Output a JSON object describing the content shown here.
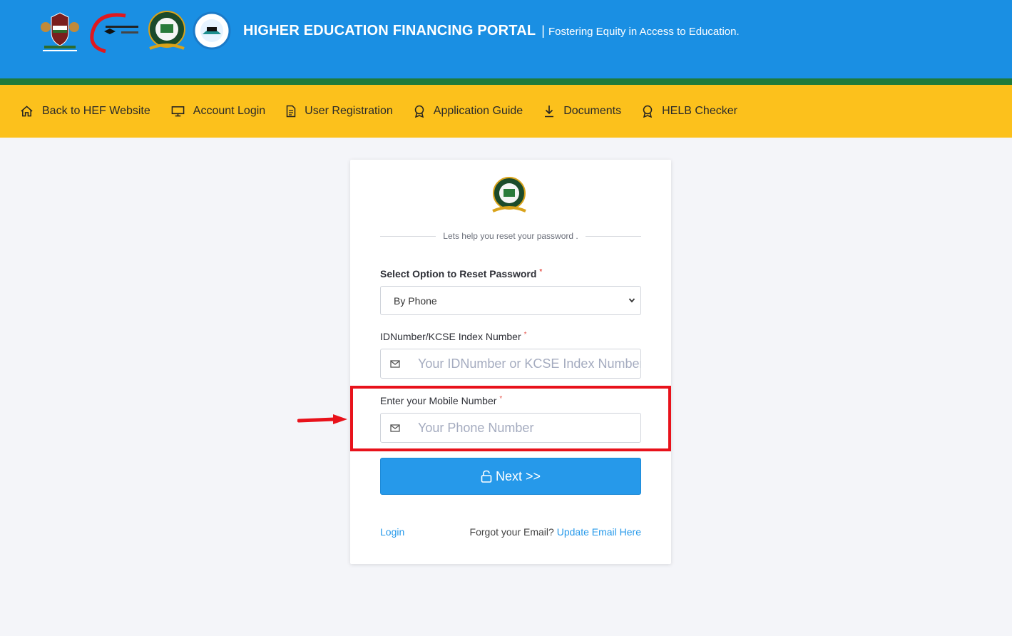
{
  "header": {
    "title": "HIGHER EDUCATION FINANCING PORTAL",
    "separator": "|",
    "tagline": "Fostering Equity in Access to Education."
  },
  "nav": [
    {
      "label": "Back to HEF Website",
      "icon": "home-icon"
    },
    {
      "label": "Account Login",
      "icon": "monitor-icon"
    },
    {
      "label": "User Registration",
      "icon": "document-icon"
    },
    {
      "label": "Application Guide",
      "icon": "award-icon"
    },
    {
      "label": "Documents",
      "icon": "download-icon"
    },
    {
      "label": "HELB Checker",
      "icon": "award-icon"
    }
  ],
  "form": {
    "subtitle": "Lets help you reset your password .",
    "option_label": "Select Option to Reset Password",
    "option_selected": "By Phone",
    "id_label": "IDNumber/KCSE Index Number",
    "id_placeholder": "Your IDNumber or KCSE Index Number",
    "phone_label": "Enter your Mobile Number",
    "phone_placeholder": "Your Phone Number",
    "required_mark": "*",
    "next_button": "Next >>",
    "login_link": "Login",
    "forgot_email_text": "Forgot your Email?",
    "update_email_link": "Update Email Here"
  },
  "colors": {
    "header_blue": "#1a8fe3",
    "nav_yellow": "#fcc11c",
    "accent_green": "#1f7a3a",
    "button_blue": "#2699ea",
    "highlight_red": "#e8121b"
  }
}
